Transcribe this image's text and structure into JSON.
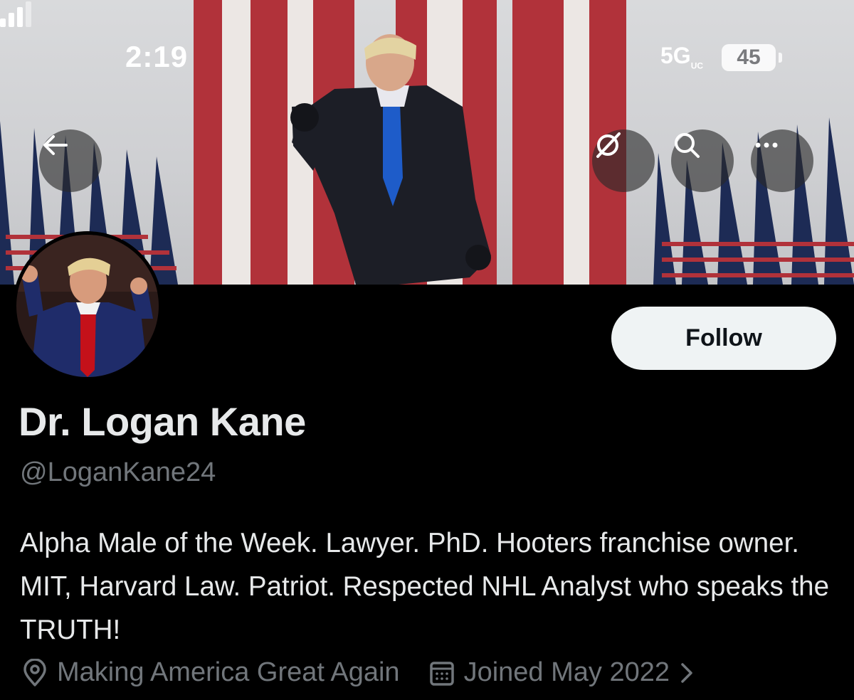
{
  "status_bar": {
    "time": "2:19",
    "network": "5G",
    "network_badge": "UC",
    "battery": "45"
  },
  "header_actions": {
    "back_icon": "arrow-left-icon",
    "grok_icon": "slash-circle-icon",
    "search_icon": "search-icon",
    "more_icon": "ellipsis-icon"
  },
  "profile": {
    "follow_label": "Follow",
    "display_name": "Dr. Logan Kane",
    "handle": "@LoganKane24",
    "bio": "Alpha Male of the Week. Lawyer. PhD. Hooters franchise owner. MIT, Harvard Law. Patriot. Respected NHL Analyst who speaks the TRUTH!",
    "location": "Making America Great Again",
    "joined": "Joined May 2022"
  },
  "colors": {
    "background": "#000000",
    "primary_text": "#e7e9ea",
    "secondary_text": "#71767b",
    "follow_bg": "#eff3f4"
  }
}
